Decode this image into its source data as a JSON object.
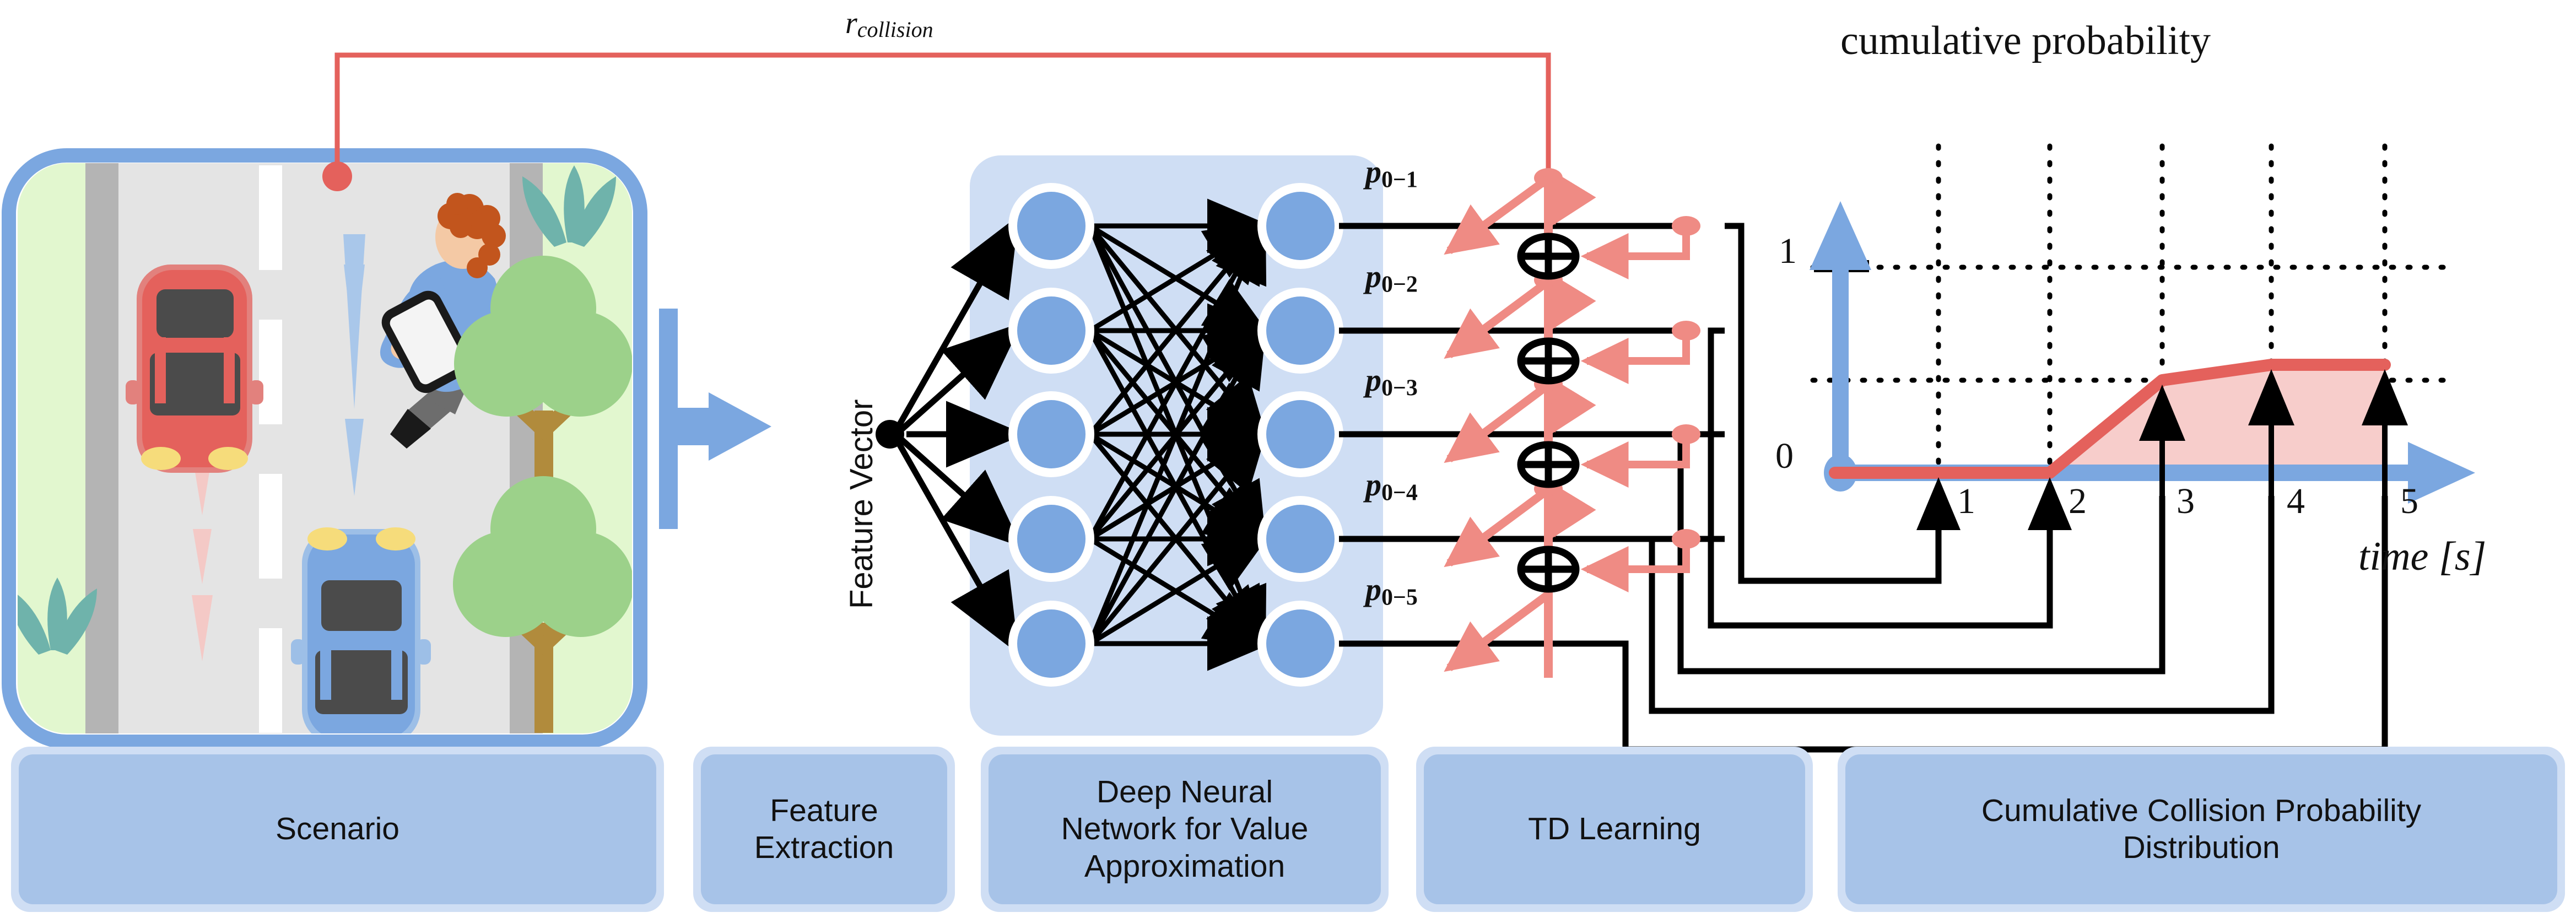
{
  "diagram": {
    "reward_label": {
      "symbol": "r",
      "subscript": "collision"
    },
    "feature_vector_label": "Feature Vector",
    "network_outputs": [
      {
        "symbol": "p",
        "subscript": "0−1"
      },
      {
        "symbol": "p",
        "subscript": "0−2"
      },
      {
        "symbol": "p",
        "subscript": "0−3"
      },
      {
        "symbol": "p",
        "subscript": "0−4"
      },
      {
        "symbol": "p",
        "subscript": "0−5"
      }
    ],
    "sum_operator_glyph": "⊕",
    "sum_operator_count": 4,
    "network": {
      "input_nodes": 5,
      "output_nodes": 5
    }
  },
  "chart_data": {
    "type": "line",
    "title": "cumulative probability",
    "xlabel": "time [s]",
    "ylabel": "cumulative probability",
    "x": [
      0,
      1,
      2,
      3,
      4,
      5
    ],
    "values": [
      0,
      0,
      0,
      0.52,
      0.55,
      0.55
    ],
    "categories": [
      "0",
      "1",
      "2",
      "3",
      "4",
      "5"
    ],
    "xtick_labels": [
      "1",
      "2",
      "3",
      "4",
      "5"
    ],
    "ytick_labels": [
      "0",
      "1"
    ],
    "ylim": [
      0,
      1.05
    ],
    "xlim": [
      0,
      5.6
    ],
    "grid": true,
    "gridlines_y": [
      0.55,
      1.0
    ],
    "gridlines_x": [
      1,
      2,
      3,
      4,
      5
    ],
    "series_color": "#e4615c",
    "fill_color": "#f7cdcb",
    "axis_color": "#7ba7e0",
    "legend": "none",
    "arrow_markers_x": [
      1,
      2,
      3,
      4,
      5
    ]
  },
  "stages": [
    {
      "id": "scenario",
      "label": "Scenario"
    },
    {
      "id": "feature-extraction",
      "label": "Feature\nExtraction"
    },
    {
      "id": "dnn",
      "label": "Deep Neural\nNetwork for Value\nApproximation"
    },
    {
      "id": "td-learning",
      "label": "TD Learning"
    },
    {
      "id": "ccpd",
      "label": "Cumulative Collision Probability\nDistribution"
    }
  ],
  "scenario": {
    "icons": [
      "red-car-icon",
      "blue-car-icon",
      "pedestrian-icon",
      "smartphone-icon",
      "tree-icon",
      "bush-icon",
      "road-icon",
      "lane-marking-icon",
      "trajectory-arrow-icon",
      "braking-trajectory-icon"
    ]
  },
  "colors": {
    "blue_accent": "#7ba7e0",
    "blue_node": "#7ba7e0",
    "blue_panel": "#cfdef4",
    "red_accent": "#e4615c",
    "red_fill": "#f7cdcb",
    "stage_outer": "#cfdef4",
    "stage_inner": "#a7c3e8",
    "grass": "#e2f7cf",
    "road": "#e4e4e4",
    "shoulder": "#b4b4b4",
    "car_red": "#e4615c",
    "car_blue": "#7ba7e0",
    "tree_green": "#9cd18a",
    "leaf_teal": "#6fb3ab"
  }
}
